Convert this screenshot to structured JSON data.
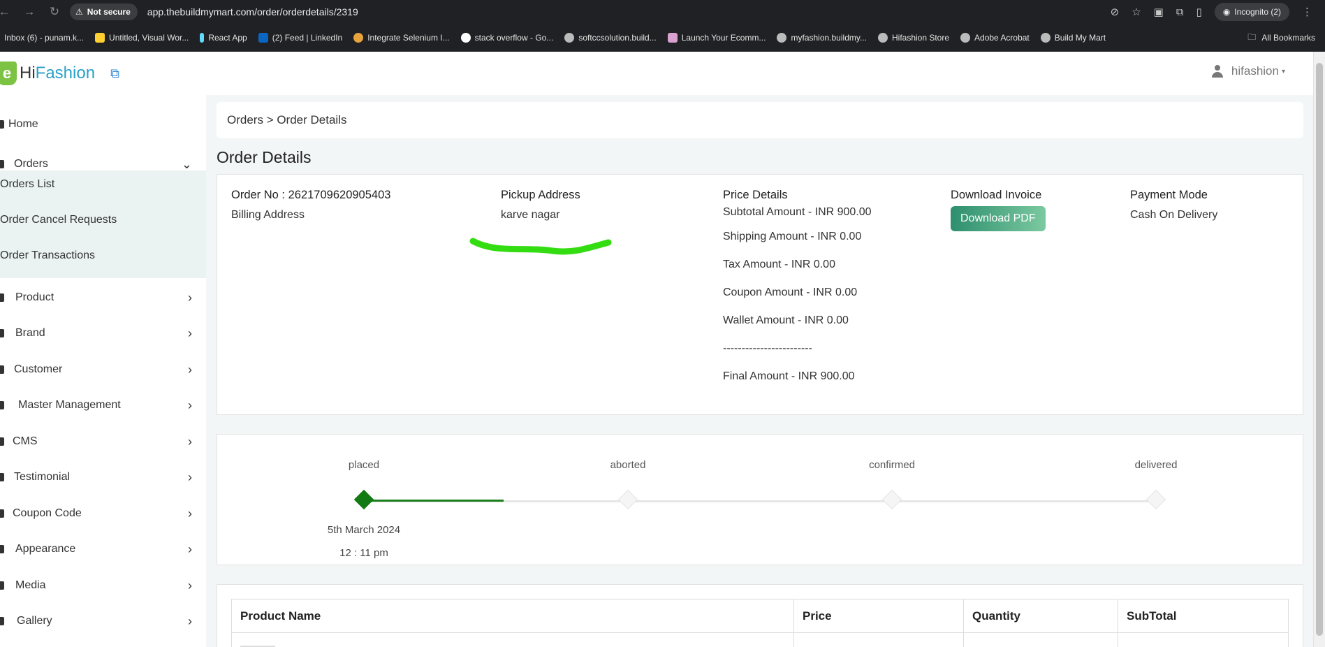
{
  "browser": {
    "security_label": "Not secure",
    "url": "app.thebuildmymart.com/order/orderdetails/2319",
    "incognito_label": "Incognito (2)",
    "bookmarks": [
      "Inbox (6) - punam.k...",
      "Untitled, Visual Wor...",
      "React App",
      "(2) Feed | LinkedIn",
      "Integrate Selenium I...",
      "stack overflow - Go...",
      "softccsolution.build...",
      "Launch Your Ecomm...",
      "myfashion.buildmy...",
      "Hifashion Store",
      "Adobe Acrobat",
      "Build My Mart"
    ],
    "all_bookmarks_label": "All Bookmarks"
  },
  "header": {
    "brand_prefix": "Hi",
    "brand_suffix": "Fashion",
    "logo_letter": "e",
    "username": "hifashion"
  },
  "sidebar": {
    "home": "Home",
    "orders": "Orders",
    "submenu": [
      "Orders List",
      "Order Cancel Requests",
      "Order Transactions"
    ],
    "items": [
      "Product",
      "Brand",
      "Customer",
      "Master Management",
      "CMS",
      "Testimonial",
      "Coupon Code",
      "Appearance",
      "Media",
      "Gallery"
    ]
  },
  "breadcrumb": "Orders > Order Details",
  "page_title": "Order Details",
  "order": {
    "order_no": "Order No : 2621709620905403",
    "billing_label": "Billing Address",
    "pickup_label": "Pickup Address",
    "pickup_value": "karve nagar",
    "price_label": "Price Details",
    "price_lines": [
      "Subtotal Amount - INR 900.00",
      "Shipping Amount - INR 0.00",
      "Tax Amount - INR 0.00",
      "Coupon Amount - INR 0.00",
      "Wallet Amount - INR 0.00",
      "------------------------",
      "Final Amount - INR 900.00"
    ],
    "invoice_label": "Download Invoice",
    "invoice_button": "Download PDF",
    "payment_label": "Payment Mode",
    "payment_value": "Cash On Delivery"
  },
  "timeline": {
    "steps": [
      "placed",
      "aborted",
      "confirmed",
      "delivered"
    ],
    "active_step": 0,
    "date": "5th March 2024",
    "time": "12 : 11 pm"
  },
  "table": {
    "headers": [
      "Product Name",
      "Price",
      "Quantity",
      "SubTotal"
    ]
  },
  "colors": {
    "accent_green": "#127a12",
    "brand_blue": "#2aa0c8",
    "scribble": "#33dd11"
  }
}
